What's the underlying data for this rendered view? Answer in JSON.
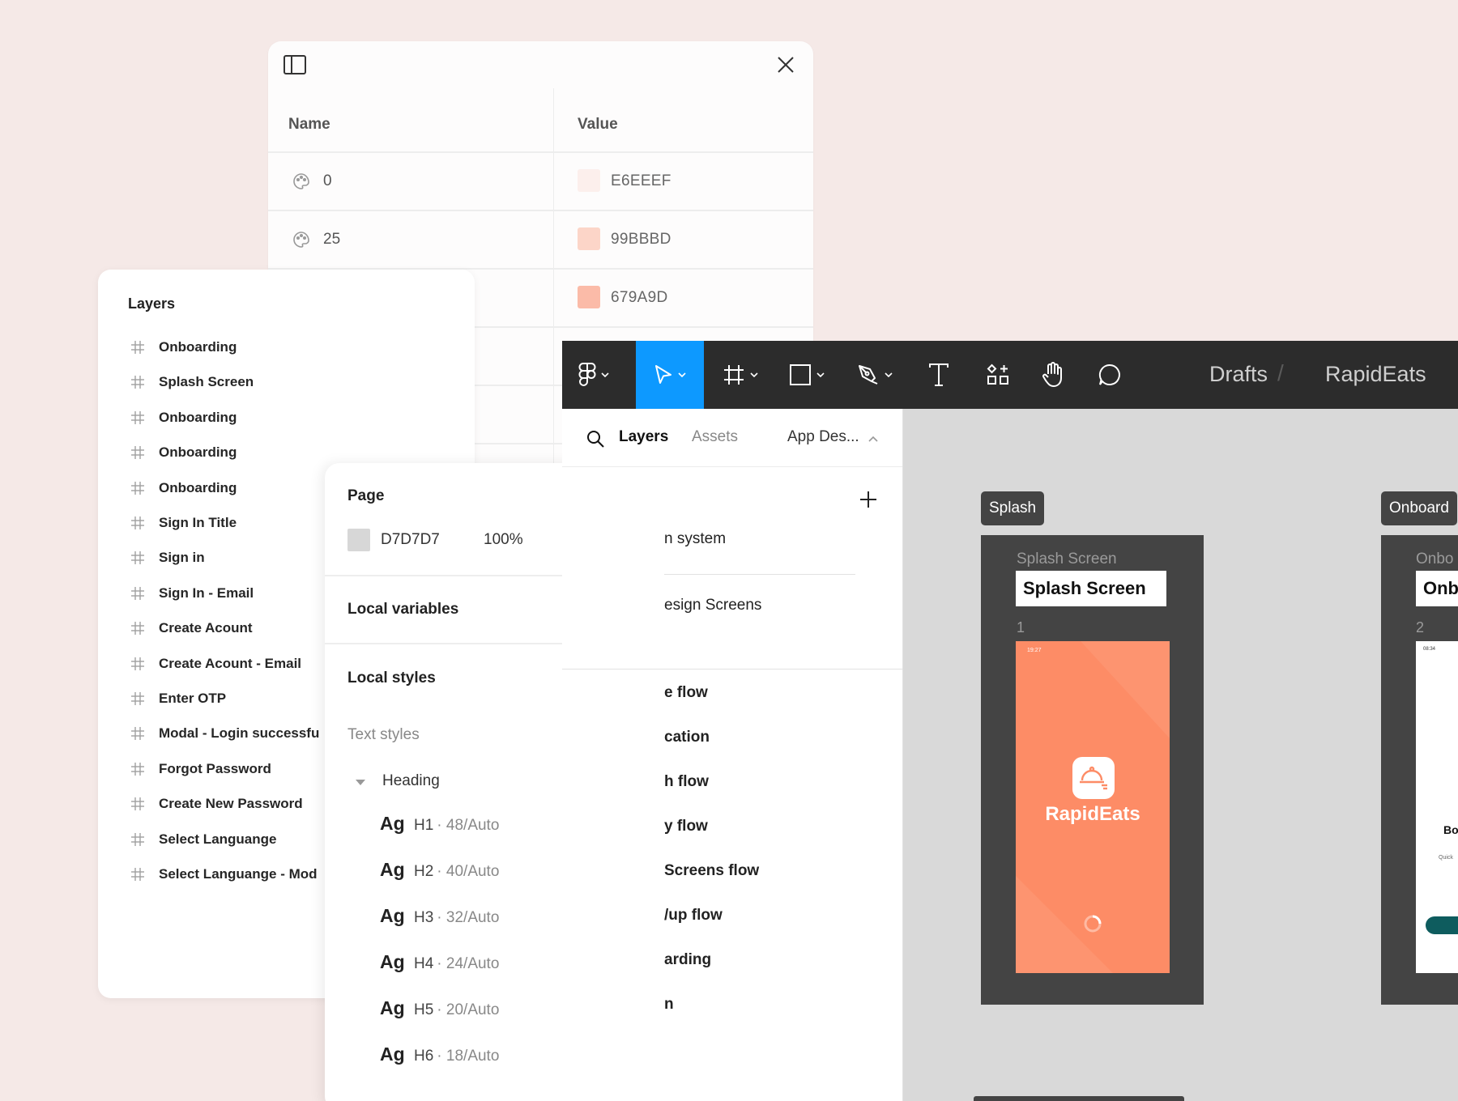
{
  "variables_panel": {
    "columns": {
      "name": "Name",
      "value": "Value"
    },
    "rows": [
      {
        "name": "0",
        "value": "E6EEEF",
        "color": "#fcefec"
      },
      {
        "name": "25",
        "value": "99BBBD",
        "color": "#fcd5c8"
      },
      {
        "name": "",
        "value": "679A9D",
        "color": "#fbbba8"
      }
    ]
  },
  "layers_panel": {
    "title": "Layers",
    "items": [
      "Onboarding",
      "Splash Screen",
      "Onboarding",
      "Onboarding",
      "Onboarding",
      "Sign In Title",
      "Sign in",
      "Sign In  - Email",
      "Create Acount",
      "Create Acount - Email",
      "Enter OTP",
      "Modal - Login successfu",
      "Forgot Password",
      "Create New Password",
      "Select Languange",
      "Select Languange - Mod"
    ]
  },
  "page_panel": {
    "page_title": "Page",
    "page_color": "D7D7D7",
    "page_opacity": "100%",
    "local_variables": "Local variables",
    "local_styles": "Local styles",
    "text_styles": "Text styles",
    "heading_group": "Heading",
    "text_styles_list": [
      {
        "sample": "Ag",
        "name": "H1",
        "meta": "· 48/Auto"
      },
      {
        "sample": "Ag",
        "name": "H2",
        "meta": "· 40/Auto"
      },
      {
        "sample": "Ag",
        "name": "H3",
        "meta": "· 32/Auto"
      },
      {
        "sample": "Ag",
        "name": "H4",
        "meta": "· 24/Auto"
      },
      {
        "sample": "Ag",
        "name": "H5",
        "meta": "· 20/Auto"
      },
      {
        "sample": "Ag",
        "name": "H6",
        "meta": "· 18/Auto"
      }
    ]
  },
  "editor": {
    "breadcrumb": {
      "drafts": "Drafts",
      "separator": "/",
      "file": "RapidEats"
    },
    "toolbar": [
      "figma-menu",
      "move",
      "frame",
      "shape",
      "pen",
      "text",
      "resources",
      "hand",
      "comment"
    ],
    "accent_color": "#0d99ff",
    "sidebar": {
      "tab_layers": "Layers",
      "tab_assets": "Assets",
      "page_selector": "App Des...",
      "pages": [
        "n system",
        "esign Screens",
        "e flow",
        "cation",
        "h flow",
        "y flow",
        " Screens flow",
        "/up flow",
        "arding",
        "n"
      ]
    },
    "canvas": {
      "splash": {
        "tag": "Splash",
        "label": "Splash Screen",
        "title": "Splash Screen",
        "number": "1",
        "app_name": "RapidEats",
        "time": "19:27",
        "brand_color": "#fd8c66"
      },
      "onboarding": {
        "tag": "Onboard",
        "label": "Onbo",
        "title": "Onb",
        "number": "2",
        "time": "08:34",
        "body_text": "Bo",
        "small_text": "Quick"
      }
    }
  }
}
